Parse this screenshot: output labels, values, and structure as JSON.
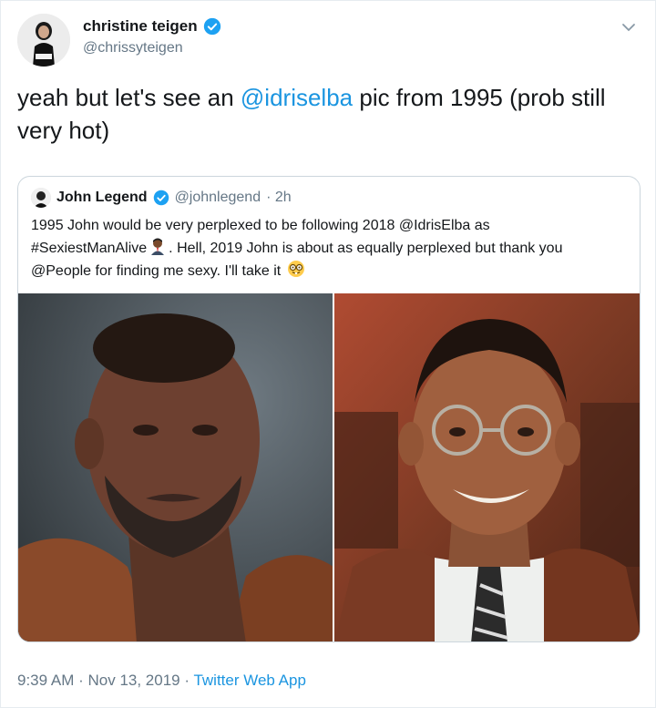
{
  "author": {
    "name": "christine teigen",
    "handle": "@chrissyteigen",
    "avatar": "avatar-photo",
    "verified_icon": "verified-badge-icon"
  },
  "tweet": {
    "text_before": "yeah but let's see an ",
    "mention": "@idriselba",
    "text_after": " pic from 1995 (prob still very hot)"
  },
  "quoted": {
    "name": "John Legend",
    "handle": "@johnlegend",
    "time": "· 2h",
    "line1": "1995 John would be very perplexed to be following 2018 @IdrisElba as",
    "line2_before": "#SexiestManAlive",
    "line2_after": ". Hell, 2019 John is about as equally perplexed but thank you",
    "line3": "@People for finding me sexy.  I'll take it",
    "emoji1": "man-emoji",
    "emoji2": "nerd-face-emoji",
    "photos": [
      "photo-idris-elba",
      "photo-john-legend-1995"
    ]
  },
  "meta": {
    "time": "9:39 AM",
    "sep1": " · ",
    "date": "Nov 13, 2019",
    "sep2": " · ",
    "source": "Twitter Web App"
  },
  "colors": {
    "link": "#1b95e0",
    "muted": "#657786",
    "verified": "#1da1f2"
  }
}
